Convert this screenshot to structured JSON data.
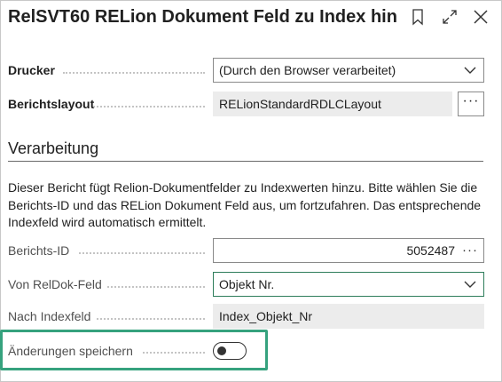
{
  "dialog": {
    "title": "RelSVT60 RELion Dokument Feld zu Index hin..."
  },
  "header_icons": [
    "bookmark-icon",
    "expand-icon",
    "close-icon"
  ],
  "printer": {
    "label": "Drucker",
    "value": "(Durch den Browser verarbeitet)"
  },
  "report_layout": {
    "label": "Berichtslayout",
    "value": "RELionStandardRDLCLayout",
    "button_label": "···"
  },
  "section": {
    "title": "Verarbeitung",
    "description": "Dieser Bericht fügt Relion-Dokumentfelder zu Indexwerten hinzu. Bitte wählen Sie die Berichts-ID und das RELion Dokument Feld aus, um fortzufahren. Das entsprechende Indexfeld wird automatisch ermittelt."
  },
  "report_id": {
    "label": "Berichts-ID",
    "value": "5052487",
    "lookup": "···"
  },
  "from_field": {
    "label": "Von RelDok-Feld",
    "value": "Objekt Nr."
  },
  "to_field": {
    "label": "Nach Indexfeld",
    "value": "Index_Objekt_Nr"
  },
  "save_changes": {
    "label": "Änderungen speichern",
    "enabled": false
  },
  "colors": {
    "highlight": "#36a27e",
    "active_border": "#2e7d5b"
  }
}
